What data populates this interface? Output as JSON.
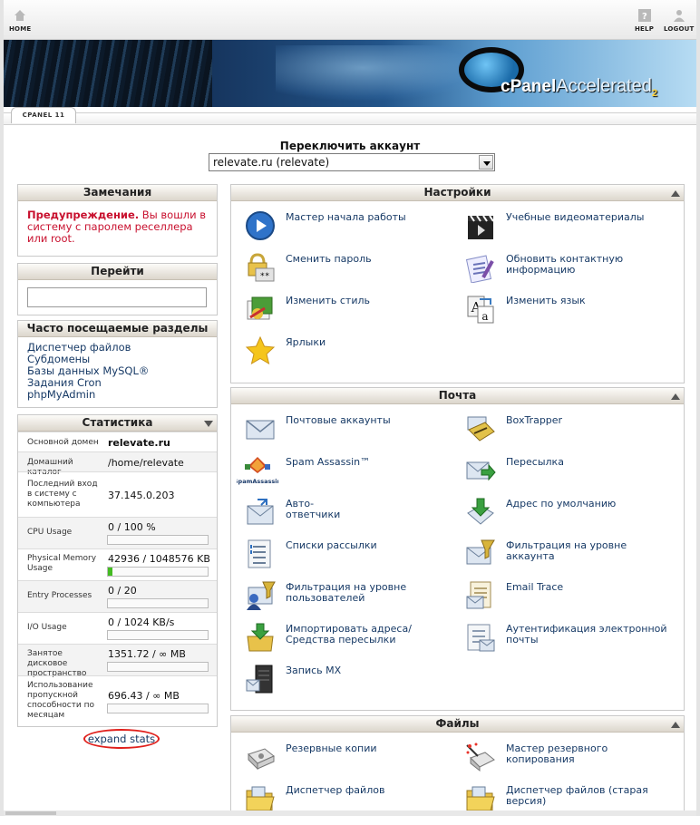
{
  "topbar": {
    "home": "HOME",
    "help": "HELP",
    "logout": "LOGOUT"
  },
  "banner": {
    "brand": "cPanel",
    "brand_suffix": "Accelerated",
    "version_mark": "2",
    "tab_label": "CPANEL 11"
  },
  "account": {
    "title": "Переключить аккаунт",
    "selected": "relevate.ru (relevate)"
  },
  "notes": {
    "title": "Замечания",
    "warning_strong": "Предупреждение.",
    "warning_text": " Вы вошли в систему с паролем реселлера или root."
  },
  "goto": {
    "title": "Перейти",
    "value": ""
  },
  "frequent": {
    "title": "Часто посещаемые разделы",
    "links": [
      "Диспетчер файлов",
      "Субдомены",
      "Базы данных MySQL®",
      "Задания Cron",
      "phpMyAdmin"
    ]
  },
  "stats": {
    "title": "Статистика",
    "rows": [
      {
        "label": "Основной домен",
        "value": "relevate.ru"
      },
      {
        "label": "Домашний каталог",
        "value": "/home/relevate"
      },
      {
        "label": "Последний вход в систему с компьютера",
        "value": "37.145.0.203"
      },
      {
        "label": "CPU Usage",
        "value": "0 / 100 %",
        "fill": 0
      },
      {
        "label": "Physical Memory Usage",
        "value": "42936 / 1048576 KB",
        "fill": 0.041
      },
      {
        "label": "Entry Processes",
        "value": "0 / 20",
        "fill": 0
      },
      {
        "label": "I/O Usage",
        "value": "0 / 1024 KB/s",
        "fill": 0
      },
      {
        "label": "Занятое дисковое пространство",
        "value": "1351.72 / ∞ MB",
        "fill": 0
      },
      {
        "label": "Использование пропускной способности по месяцам",
        "value": "696.43 / ∞ MB",
        "fill": 0
      }
    ],
    "expand": "expand stats"
  },
  "settings": {
    "title": "Настройки",
    "items": [
      {
        "label": "Мастер начала работы",
        "icon": "play-icon"
      },
      {
        "label": "Учебные видеоматериалы",
        "icon": "video-clapper-icon"
      },
      {
        "label": "Сменить пароль",
        "icon": "password-lock-icon"
      },
      {
        "label": "Обновить контактную информацию",
        "icon": "contact-card-icon"
      },
      {
        "label": "Изменить стиль",
        "icon": "style-palette-icon"
      },
      {
        "label": "Изменить язык",
        "icon": "language-icon"
      },
      {
        "label": "Ярлыки",
        "icon": "star-icon"
      }
    ]
  },
  "mail": {
    "title": "Почта",
    "items": [
      {
        "label": "Почтовые аккаунты",
        "icon": "envelope-icon"
      },
      {
        "label": "BoxTrapper",
        "icon": "boxtrapper-icon"
      },
      {
        "label": "Spam Assassin™",
        "icon": "spamassassin-icon",
        "sub": "SpamAssassin"
      },
      {
        "label": "Пересылка",
        "icon": "forward-icon"
      },
      {
        "label": "Авто-\nответчики",
        "icon": "autoresponder-icon"
      },
      {
        "label": "Адрес по умолчанию",
        "icon": "default-address-icon"
      },
      {
        "label": "Списки рассылки",
        "icon": "mailing-list-icon"
      },
      {
        "label": "Фильтрация на уровне аккаунта",
        "icon": "account-filter-icon"
      },
      {
        "label": "Фильтрация на уровне пользователей",
        "icon": "user-filter-icon"
      },
      {
        "label": "Email Trace",
        "icon": "email-trace-icon"
      },
      {
        "label": "Импортировать адреса/ Средства пересылки",
        "icon": "import-icon"
      },
      {
        "label": "Аутентификация электронной почты",
        "icon": "email-auth-icon"
      },
      {
        "label": "Запись MX",
        "icon": "mx-server-icon"
      }
    ]
  },
  "files": {
    "title": "Файлы",
    "items": [
      {
        "label": "Резервные копии",
        "icon": "backup-drive-icon"
      },
      {
        "label": "Мастер резервного копирования",
        "icon": "backup-wizard-icon"
      },
      {
        "label": "Диспетчер файлов",
        "icon": "folder-icon"
      },
      {
        "label": "Диспетчер файлов (старая версия)",
        "icon": "folder-legacy-icon"
      }
    ]
  },
  "colors": {
    "warning": "#c8102e",
    "link": "#173a66",
    "header_bg": "#dcd6cc",
    "bar_fill": "#44bb22"
  }
}
